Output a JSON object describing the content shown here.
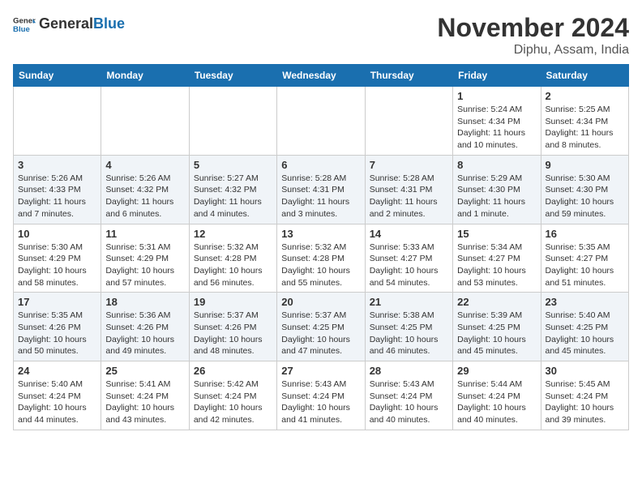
{
  "header": {
    "logo_general": "General",
    "logo_blue": "Blue",
    "month_title": "November 2024",
    "location": "Diphu, Assam, India"
  },
  "days_of_week": [
    "Sunday",
    "Monday",
    "Tuesday",
    "Wednesday",
    "Thursday",
    "Friday",
    "Saturday"
  ],
  "weeks": [
    [
      {
        "day": "",
        "info": ""
      },
      {
        "day": "",
        "info": ""
      },
      {
        "day": "",
        "info": ""
      },
      {
        "day": "",
        "info": ""
      },
      {
        "day": "",
        "info": ""
      },
      {
        "day": "1",
        "info": "Sunrise: 5:24 AM\nSunset: 4:34 PM\nDaylight: 11 hours and 10 minutes."
      },
      {
        "day": "2",
        "info": "Sunrise: 5:25 AM\nSunset: 4:34 PM\nDaylight: 11 hours and 8 minutes."
      }
    ],
    [
      {
        "day": "3",
        "info": "Sunrise: 5:26 AM\nSunset: 4:33 PM\nDaylight: 11 hours and 7 minutes."
      },
      {
        "day": "4",
        "info": "Sunrise: 5:26 AM\nSunset: 4:32 PM\nDaylight: 11 hours and 6 minutes."
      },
      {
        "day": "5",
        "info": "Sunrise: 5:27 AM\nSunset: 4:32 PM\nDaylight: 11 hours and 4 minutes."
      },
      {
        "day": "6",
        "info": "Sunrise: 5:28 AM\nSunset: 4:31 PM\nDaylight: 11 hours and 3 minutes."
      },
      {
        "day": "7",
        "info": "Sunrise: 5:28 AM\nSunset: 4:31 PM\nDaylight: 11 hours and 2 minutes."
      },
      {
        "day": "8",
        "info": "Sunrise: 5:29 AM\nSunset: 4:30 PM\nDaylight: 11 hours and 1 minute."
      },
      {
        "day": "9",
        "info": "Sunrise: 5:30 AM\nSunset: 4:30 PM\nDaylight: 10 hours and 59 minutes."
      }
    ],
    [
      {
        "day": "10",
        "info": "Sunrise: 5:30 AM\nSunset: 4:29 PM\nDaylight: 10 hours and 58 minutes."
      },
      {
        "day": "11",
        "info": "Sunrise: 5:31 AM\nSunset: 4:29 PM\nDaylight: 10 hours and 57 minutes."
      },
      {
        "day": "12",
        "info": "Sunrise: 5:32 AM\nSunset: 4:28 PM\nDaylight: 10 hours and 56 minutes."
      },
      {
        "day": "13",
        "info": "Sunrise: 5:32 AM\nSunset: 4:28 PM\nDaylight: 10 hours and 55 minutes."
      },
      {
        "day": "14",
        "info": "Sunrise: 5:33 AM\nSunset: 4:27 PM\nDaylight: 10 hours and 54 minutes."
      },
      {
        "day": "15",
        "info": "Sunrise: 5:34 AM\nSunset: 4:27 PM\nDaylight: 10 hours and 53 minutes."
      },
      {
        "day": "16",
        "info": "Sunrise: 5:35 AM\nSunset: 4:27 PM\nDaylight: 10 hours and 51 minutes."
      }
    ],
    [
      {
        "day": "17",
        "info": "Sunrise: 5:35 AM\nSunset: 4:26 PM\nDaylight: 10 hours and 50 minutes."
      },
      {
        "day": "18",
        "info": "Sunrise: 5:36 AM\nSunset: 4:26 PM\nDaylight: 10 hours and 49 minutes."
      },
      {
        "day": "19",
        "info": "Sunrise: 5:37 AM\nSunset: 4:26 PM\nDaylight: 10 hours and 48 minutes."
      },
      {
        "day": "20",
        "info": "Sunrise: 5:37 AM\nSunset: 4:25 PM\nDaylight: 10 hours and 47 minutes."
      },
      {
        "day": "21",
        "info": "Sunrise: 5:38 AM\nSunset: 4:25 PM\nDaylight: 10 hours and 46 minutes."
      },
      {
        "day": "22",
        "info": "Sunrise: 5:39 AM\nSunset: 4:25 PM\nDaylight: 10 hours and 45 minutes."
      },
      {
        "day": "23",
        "info": "Sunrise: 5:40 AM\nSunset: 4:25 PM\nDaylight: 10 hours and 45 minutes."
      }
    ],
    [
      {
        "day": "24",
        "info": "Sunrise: 5:40 AM\nSunset: 4:24 PM\nDaylight: 10 hours and 44 minutes."
      },
      {
        "day": "25",
        "info": "Sunrise: 5:41 AM\nSunset: 4:24 PM\nDaylight: 10 hours and 43 minutes."
      },
      {
        "day": "26",
        "info": "Sunrise: 5:42 AM\nSunset: 4:24 PM\nDaylight: 10 hours and 42 minutes."
      },
      {
        "day": "27",
        "info": "Sunrise: 5:43 AM\nSunset: 4:24 PM\nDaylight: 10 hours and 41 minutes."
      },
      {
        "day": "28",
        "info": "Sunrise: 5:43 AM\nSunset: 4:24 PM\nDaylight: 10 hours and 40 minutes."
      },
      {
        "day": "29",
        "info": "Sunrise: 5:44 AM\nSunset: 4:24 PM\nDaylight: 10 hours and 40 minutes."
      },
      {
        "day": "30",
        "info": "Sunrise: 5:45 AM\nSunset: 4:24 PM\nDaylight: 10 hours and 39 minutes."
      }
    ]
  ]
}
